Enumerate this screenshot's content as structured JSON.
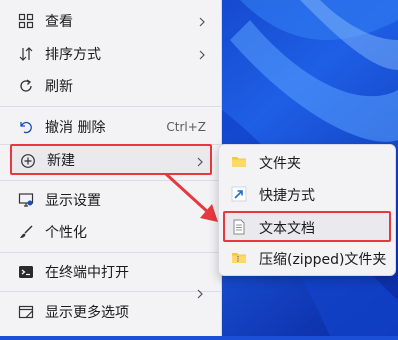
{
  "colors": {
    "highlight_border": "#e5393f",
    "menu_bg": "#f3f3f6",
    "desktop_bg": "#1c4fd8",
    "arrow": "#e5393f"
  },
  "context_menu": {
    "items": [
      {
        "label": "查看",
        "icon": "view-grid-icon",
        "has_submenu": true
      },
      {
        "label": "排序方式",
        "icon": "sort-icon",
        "has_submenu": true
      },
      {
        "label": "刷新",
        "icon": "refresh-icon"
      },
      {
        "label": "撤消 删除",
        "icon": "undo-icon",
        "shortcut": "Ctrl+Z"
      },
      {
        "label": "新建",
        "icon": "new-plus-icon",
        "has_submenu": true,
        "highlighted": true
      },
      {
        "label": "显示设置",
        "icon": "display-settings-icon"
      },
      {
        "label": "个性化",
        "icon": "personalize-brush-icon"
      },
      {
        "label": "在终端中打开",
        "icon": "terminal-icon"
      },
      {
        "label": "显示更多选项",
        "icon": "more-options-icon"
      }
    ]
  },
  "new_submenu": {
    "items": [
      {
        "label": "文件夹",
        "icon": "folder-icon"
      },
      {
        "label": "快捷方式",
        "icon": "shortcut-icon"
      },
      {
        "label": "文本文档",
        "icon": "text-document-icon",
        "highlighted": true
      },
      {
        "label": "压缩(zipped)文件夹",
        "icon": "zip-folder-icon"
      }
    ]
  }
}
